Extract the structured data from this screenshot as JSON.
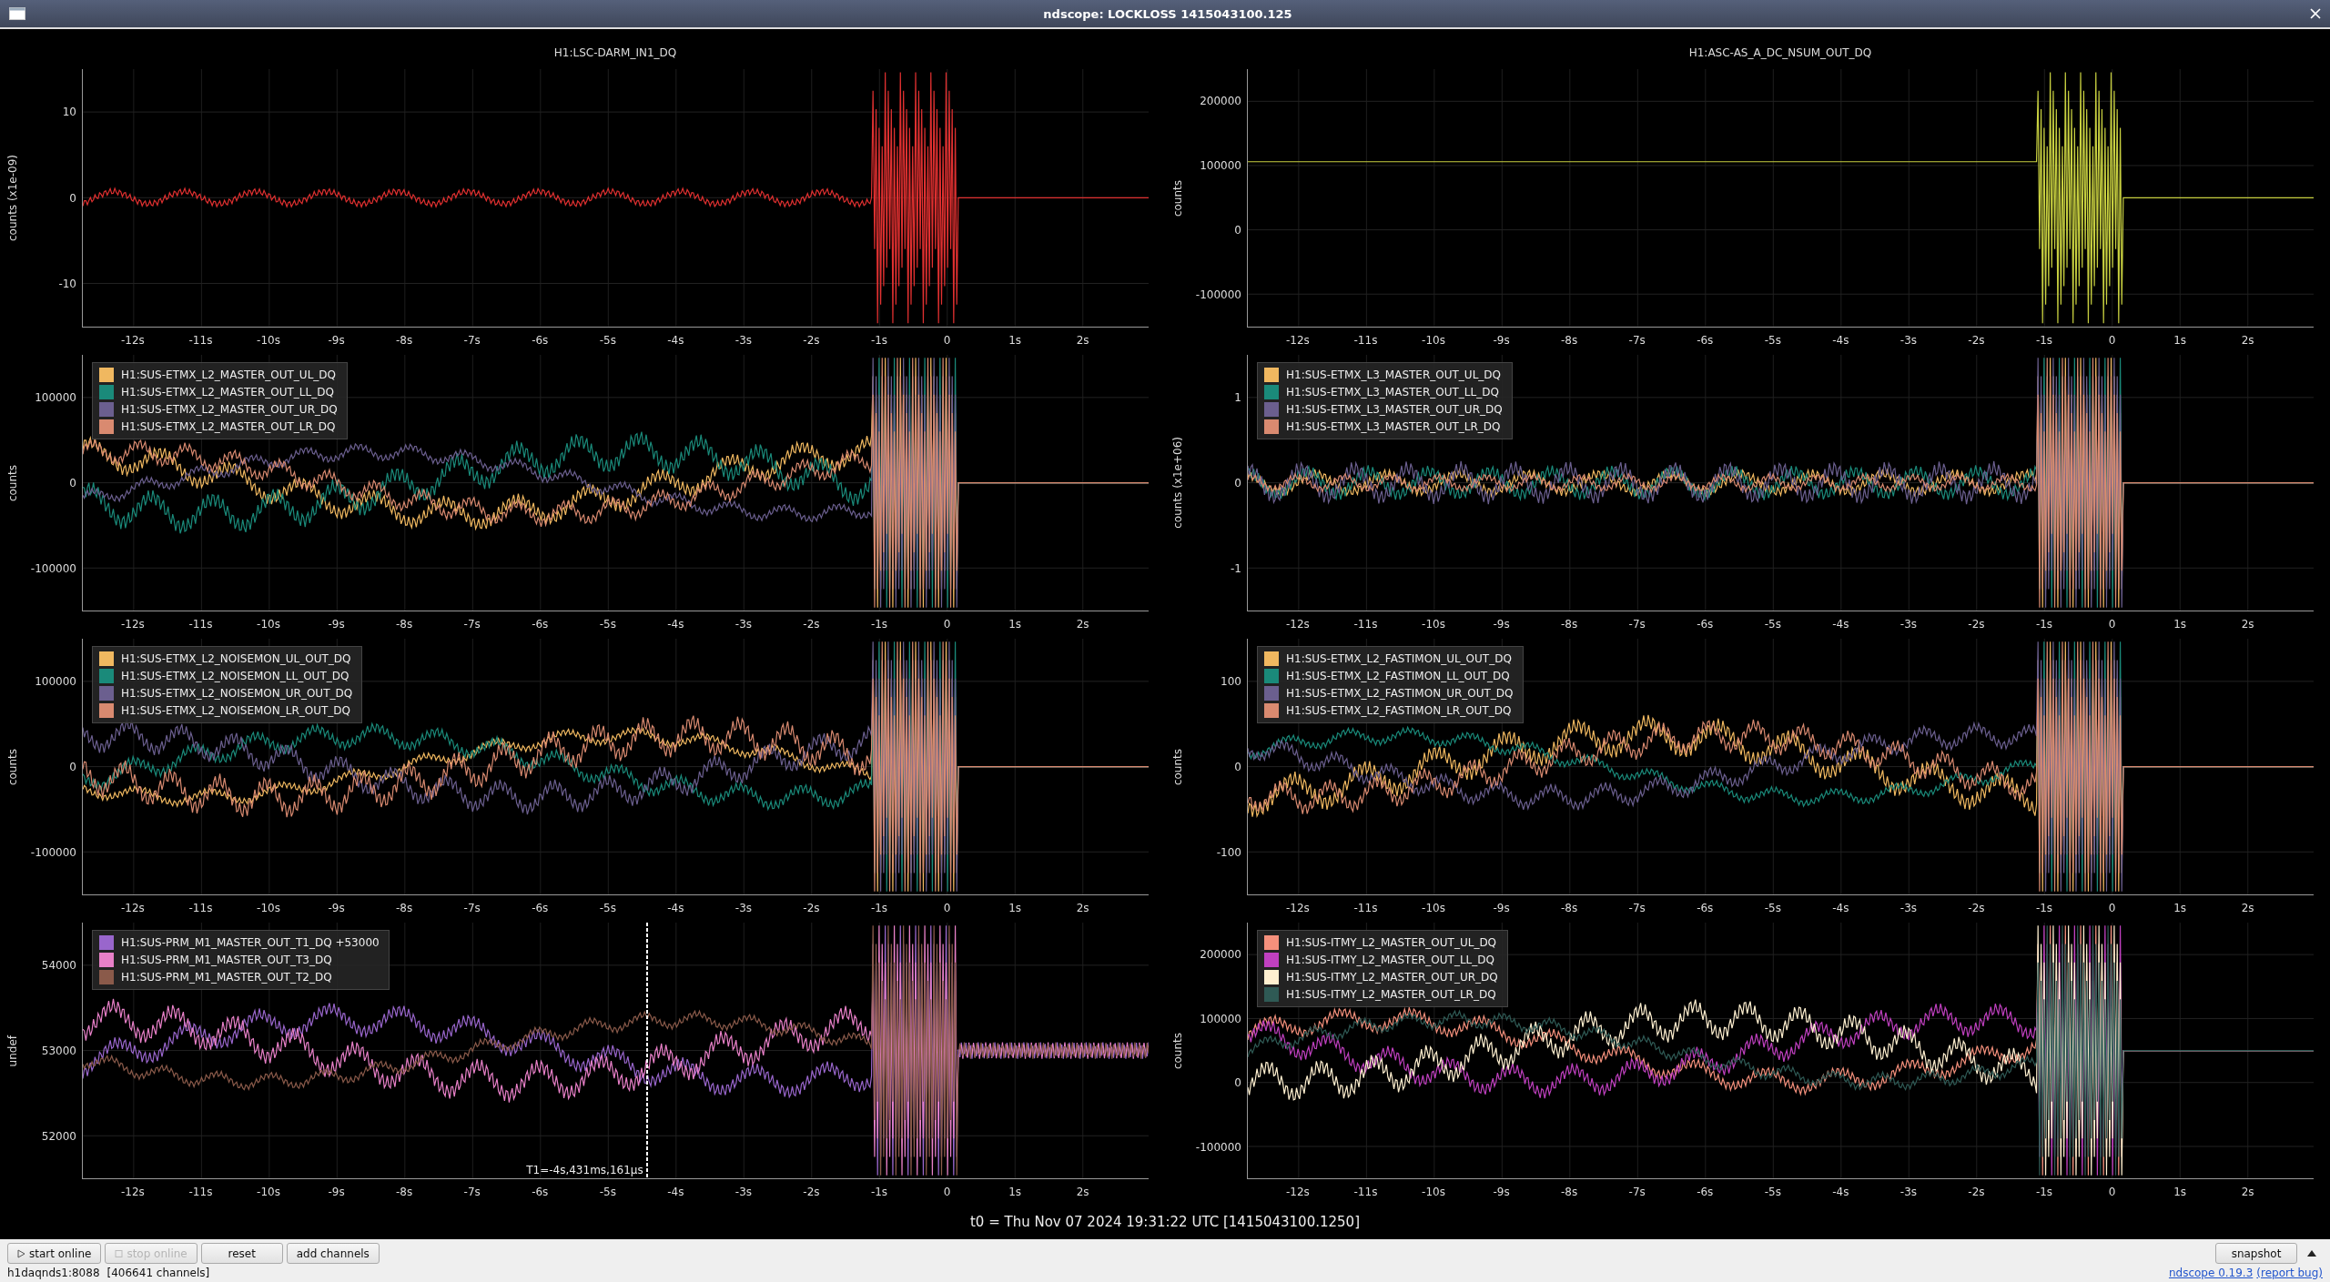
{
  "window": {
    "title": "ndscope: LOCKLOSS 1415043100.125"
  },
  "plots": [
    {
      "title": "H1:LSC-DARM_IN1_DQ",
      "ylabel": "counts (x1e-09)",
      "yticks": [
        "10",
        "0",
        "-10"
      ],
      "xticks": [
        "-12s",
        "-11s",
        "-10s",
        "-9s",
        "-8s",
        "-7s",
        "-6s",
        "-5s",
        "-4s",
        "-3s",
        "-2s",
        "-1s",
        "0",
        "1s",
        "2s"
      ],
      "series": [
        {
          "color": "#e03030"
        }
      ]
    },
    {
      "title": "H1:ASC-AS_A_DC_NSUM_OUT_DQ",
      "ylabel": "counts",
      "yticks": [
        "200000",
        "100000",
        "0",
        "-100000"
      ],
      "xticks": [
        "-12s",
        "-11s",
        "-10s",
        "-9s",
        "-8s",
        "-7s",
        "-6s",
        "-5s",
        "-4s",
        "-3s",
        "-2s",
        "-1s",
        "0",
        "1s",
        "2s"
      ],
      "series": [
        {
          "color": "#c8d040"
        }
      ]
    },
    {
      "ylabel": "counts",
      "yticks": [
        "100000",
        "0",
        "-100000"
      ],
      "xticks": [
        "-12s",
        "-11s",
        "-10s",
        "-9s",
        "-8s",
        "-7s",
        "-6s",
        "-5s",
        "-4s",
        "-3s",
        "-2s",
        "-1s",
        "0",
        "1s",
        "2s"
      ],
      "series": [
        {
          "name": "H1:SUS-ETMX_L2_MASTER_OUT_UL_DQ",
          "color": "#f0b860"
        },
        {
          "name": "H1:SUS-ETMX_L2_MASTER_OUT_LL_DQ",
          "color": "#1a8a7a"
        },
        {
          "name": "H1:SUS-ETMX_L2_MASTER_OUT_UR_DQ",
          "color": "#6b5f8f"
        },
        {
          "name": "H1:SUS-ETMX_L2_MASTER_OUT_LR_DQ",
          "color": "#d98a70"
        }
      ]
    },
    {
      "ylabel": "counts (x1e+06)",
      "yticks": [
        "1",
        "0",
        "-1"
      ],
      "xticks": [
        "-12s",
        "-11s",
        "-10s",
        "-9s",
        "-8s",
        "-7s",
        "-6s",
        "-5s",
        "-4s",
        "-3s",
        "-2s",
        "-1s",
        "0",
        "1s",
        "2s"
      ],
      "series": [
        {
          "name": "H1:SUS-ETMX_L3_MASTER_OUT_UL_DQ",
          "color": "#f0b860"
        },
        {
          "name": "H1:SUS-ETMX_L3_MASTER_OUT_LL_DQ",
          "color": "#1a8a7a"
        },
        {
          "name": "H1:SUS-ETMX_L3_MASTER_OUT_UR_DQ",
          "color": "#6b5f8f"
        },
        {
          "name": "H1:SUS-ETMX_L3_MASTER_OUT_LR_DQ",
          "color": "#d98a70"
        }
      ]
    },
    {
      "ylabel": "counts",
      "yticks": [
        "100000",
        "0",
        "-100000"
      ],
      "xticks": [
        "-12s",
        "-11s",
        "-10s",
        "-9s",
        "-8s",
        "-7s",
        "-6s",
        "-5s",
        "-4s",
        "-3s",
        "-2s",
        "-1s",
        "0",
        "1s",
        "2s"
      ],
      "series": [
        {
          "name": "H1:SUS-ETMX_L2_NOISEMON_UL_OUT_DQ",
          "color": "#f0b860"
        },
        {
          "name": "H1:SUS-ETMX_L2_NOISEMON_LL_OUT_DQ",
          "color": "#1a8a7a"
        },
        {
          "name": "H1:SUS-ETMX_L2_NOISEMON_UR_OUT_DQ",
          "color": "#6b5f8f"
        },
        {
          "name": "H1:SUS-ETMX_L2_NOISEMON_LR_OUT_DQ",
          "color": "#d98a70"
        }
      ]
    },
    {
      "ylabel": "counts",
      "yticks": [
        "100",
        "0",
        "-100"
      ],
      "xticks": [
        "-12s",
        "-11s",
        "-10s",
        "-9s",
        "-8s",
        "-7s",
        "-6s",
        "-5s",
        "-4s",
        "-3s",
        "-2s",
        "-1s",
        "0",
        "1s",
        "2s"
      ],
      "series": [
        {
          "name": "H1:SUS-ETMX_L2_FASTIMON_UL_OUT_DQ",
          "color": "#f0b860"
        },
        {
          "name": "H1:SUS-ETMX_L2_FASTIMON_LL_OUT_DQ",
          "color": "#1a8a7a"
        },
        {
          "name": "H1:SUS-ETMX_L2_FASTIMON_UR_OUT_DQ",
          "color": "#6b5f8f"
        },
        {
          "name": "H1:SUS-ETMX_L2_FASTIMON_LR_OUT_DQ",
          "color": "#d98a70"
        }
      ]
    },
    {
      "ylabel": "undef",
      "yticks": [
        "54000",
        "53000",
        "52000"
      ],
      "xticks": [
        "-12s",
        "-11s",
        "-10s",
        "-9s",
        "-8s",
        "-7s",
        "-6s",
        "-5s",
        "-4s",
        "-3s",
        "-2s",
        "-1s",
        "0",
        "1s",
        "2s"
      ],
      "series": [
        {
          "name": "H1:SUS-PRM_M1_MASTER_OUT_T1_DQ +53000",
          "color": "#9966cc"
        },
        {
          "name": "H1:SUS-PRM_M1_MASTER_OUT_T3_DQ",
          "color": "#e880c8"
        },
        {
          "name": "H1:SUS-PRM_M1_MASTER_OUT_T2_DQ",
          "color": "#8a5a4a"
        }
      ],
      "cursor": {
        "label": "T1=-4s,431ms,161µs"
      }
    },
    {
      "ylabel": "counts",
      "yticks": [
        "200000",
        "100000",
        "0",
        "-100000"
      ],
      "xticks": [
        "-12s",
        "-11s",
        "-10s",
        "-9s",
        "-8s",
        "-7s",
        "-6s",
        "-5s",
        "-4s",
        "-3s",
        "-2s",
        "-1s",
        "0",
        "1s",
        "2s"
      ],
      "series": [
        {
          "name": "H1:SUS-ITMY_L2_MASTER_OUT_UL_DQ",
          "color": "#f4907c"
        },
        {
          "name": "H1:SUS-ITMY_L2_MASTER_OUT_LL_DQ",
          "color": "#c040c0"
        },
        {
          "name": "H1:SUS-ITMY_L2_MASTER_OUT_UR_DQ",
          "color": "#fff0d0"
        },
        {
          "name": "H1:SUS-ITMY_L2_MASTER_OUT_LR_DQ",
          "color": "#2f5a55"
        }
      ]
    }
  ],
  "t0": "t0 = Thu Nov 07 2024 19:31:22 UTC [1415043100.1250]",
  "buttons": [
    {
      "label": "start online",
      "kind": "play",
      "disabled": false
    },
    {
      "label": "stop online",
      "kind": "stop",
      "disabled": true
    },
    {
      "label": "reset",
      "kind": "plain",
      "disabled": false
    },
    {
      "label": "add channels",
      "kind": "plain",
      "disabled": false
    }
  ],
  "snapshot": {
    "label": "snapshot"
  },
  "status": {
    "server": "h1daqnds1:8088",
    "channels": "[406641 channels]",
    "version_link": "ndscope 0.19.3",
    "report_link": "(report bug)"
  }
}
